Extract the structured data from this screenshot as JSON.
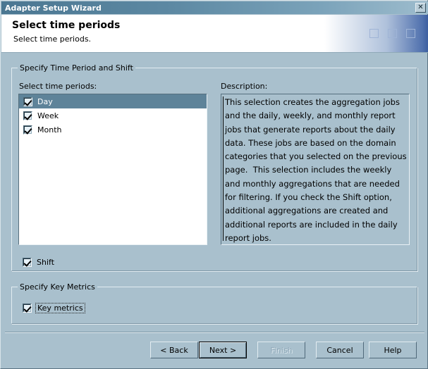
{
  "window": {
    "title": "Adapter Setup Wizard",
    "close_icon": "close-x-icon"
  },
  "header": {
    "title": "Select time periods",
    "subtitle": "Select time periods."
  },
  "groups": {
    "time_period": {
      "legend": "Specify Time Period and Shift",
      "list_label": "Select time periods:",
      "description_label": "Description:",
      "items": [
        {
          "label": "Day",
          "checked": true,
          "selected": true
        },
        {
          "label": "Week",
          "checked": true,
          "selected": false
        },
        {
          "label": "Month",
          "checked": true,
          "selected": false
        }
      ],
      "description_text": "This selection creates the aggregation jobs and the daily, weekly, and monthly report jobs that generate reports about the daily data. These jobs are based on the domain categories that you selected on the previous page.  This selection includes the weekly and monthly aggregations that are needed for filtering. If you check the Shift option, additional aggregations are created and additional reports are included in the daily report jobs.",
      "shift": {
        "label": "Shift",
        "checked": true
      }
    },
    "key_metrics": {
      "legend": "Specify Key Metrics",
      "checkbox": {
        "label": "Key metrics",
        "checked": true,
        "focused": true
      }
    }
  },
  "buttons": {
    "back": {
      "label": "< Back",
      "enabled": true,
      "default": false
    },
    "next": {
      "label": "Next >",
      "enabled": true,
      "default": true
    },
    "finish": {
      "label": "Finish",
      "enabled": false,
      "default": false
    },
    "cancel": {
      "label": "Cancel",
      "enabled": true,
      "default": false
    },
    "help": {
      "label": "Help",
      "enabled": true,
      "default": false
    }
  },
  "colors": {
    "dialog_background": "#a9c0cd",
    "titlebar_start": "#4b7792",
    "titlebar_end": "#9dbccd",
    "selection": "#5e8399",
    "listbox_background": "#ffffff",
    "disabled_text": "#8fa8b8"
  }
}
